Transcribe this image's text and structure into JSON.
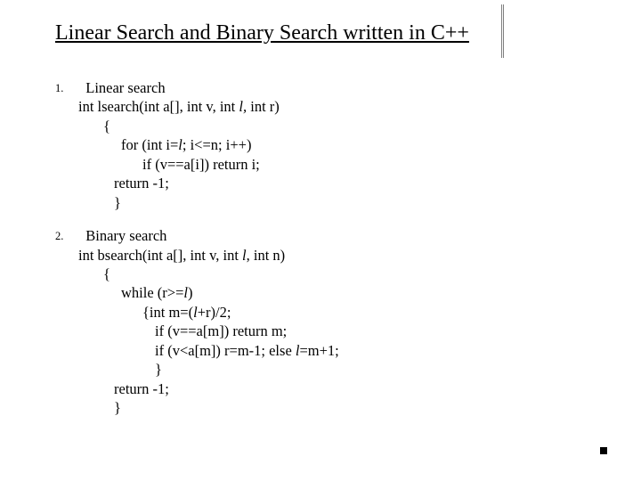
{
  "title": "Linear Search and Binary Search  written in C++",
  "items": [
    {
      "num": "1.",
      "heading": "Linear search",
      "sig_pre": "int lsearch(int a[], int v, int ",
      "sig_ital": "l, ",
      "sig_post": "int r)",
      "open_brace": "{",
      "l1_pre": "for (int i=",
      "l1_ital": "l",
      "l1_post": "; i<=n; i++)",
      "l2": "if (v==a[i]) return i;",
      "ret": "return -1;",
      "close_brace": "}"
    },
    {
      "num": "2.",
      "heading": "Binary search",
      "sig_pre": "int bsearch(int a[], int v, int ",
      "sig_ital": "l",
      "sig_post": ", int n)",
      "open_brace": "{",
      "l1_pre": "while (r>=",
      "l1_ital": "l",
      "l1_post": ")",
      "l2_pre": "{int m=(",
      "l2_ital": "l",
      "l2_post": "+r)/2;",
      "l3": "if (v==a[m]) return m;",
      "l4_pre": "if (v<a[m]) r=m-1; else ",
      "l4_ital": "l",
      "l4_post": "=m+1;",
      "l5": "}",
      "ret": "return -1;",
      "close_brace": "}"
    }
  ]
}
